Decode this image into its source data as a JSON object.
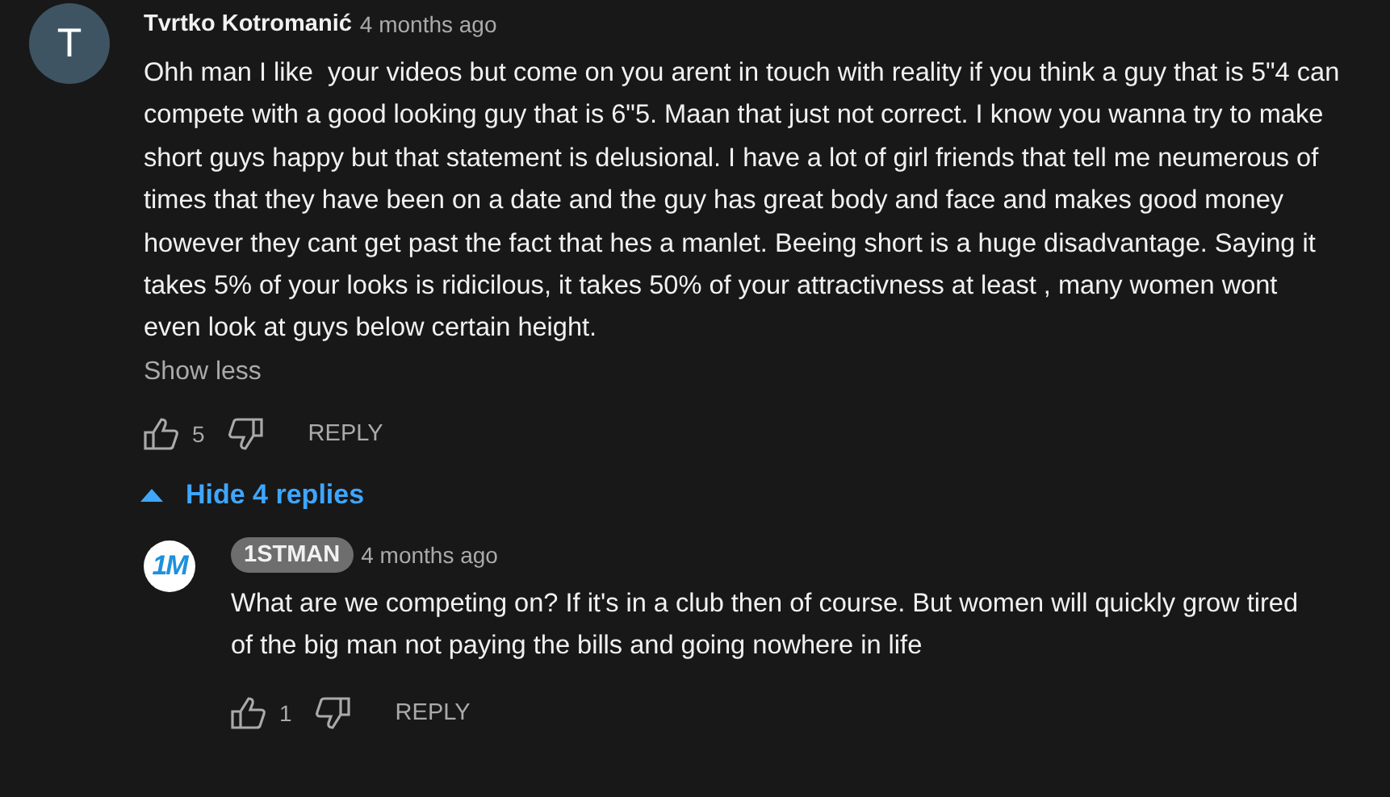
{
  "comment": {
    "author": "Tvrtko Kotromanić",
    "author_badge": false,
    "avatar": {
      "kind": "letter",
      "text": "T"
    },
    "time": "4 months ago",
    "text": "Ohh man I like  your videos but come on you arent in touch with reality if you think a guy that is 5\"4 can compete with a good looking guy that is 6\"5. Maan that just not correct. I know you wanna try to make short guys happy but that statement is delusional. I have a lot of girl friends that tell me neumerous of times that they have been on a date and the guy has great body and face and makes good money however they cant get past the fact that hes a manlet. Beeing short is a huge disadvantage. Saying it takes 5% of your looks is ridicilous, it takes 50% of your attractivness at least , many women wont even look at guys below certain height.",
    "show_less": "Show less",
    "likes": "5",
    "reply_label": "REPLY"
  },
  "replies_toggle": {
    "label": "Hide 4 replies",
    "expanded": true
  },
  "replies": [
    {
      "author": "1STMAN",
      "author_badge": true,
      "avatar": {
        "kind": "logo",
        "text": "1M"
      },
      "time": "4 months ago",
      "text": "What are we competing on? If it's in a club then of course. But women will quickly grow tired of the big man not paying the bills and going nowhere in life",
      "likes": "1",
      "reply_label": "REPLY"
    }
  ]
}
